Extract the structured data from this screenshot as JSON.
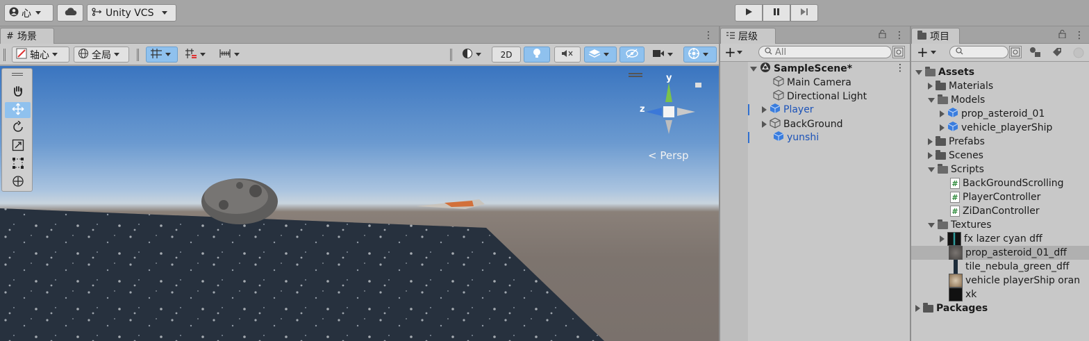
{
  "topbar": {
    "account_label": "心",
    "vcs_label": "Unity VCS"
  },
  "scene": {
    "tab_label": "场景",
    "pivot_label": "轴心",
    "global_label": "全局",
    "mode_2d_label": "2D",
    "persp_label": "< Persp",
    "gizmo_axes": {
      "y": "y",
      "z": "z"
    }
  },
  "hierarchy": {
    "tab_label": "层级",
    "search_placeholder": "All",
    "scene_name": "SampleScene*",
    "items": [
      {
        "label": "Main Camera",
        "prefab": false,
        "expandable": false
      },
      {
        "label": "Directional Light",
        "prefab": false,
        "expandable": false
      },
      {
        "label": "Player",
        "prefab": true,
        "expandable": true
      },
      {
        "label": "BackGround",
        "prefab": false,
        "expandable": true
      },
      {
        "label": "yunshi",
        "prefab": true,
        "expandable": false
      }
    ]
  },
  "project": {
    "tab_label": "项目",
    "assets_label": "Assets",
    "packages_label": "Packages",
    "folders": {
      "materials": "Materials",
      "models": "Models",
      "prefabs": "Prefabs",
      "scenes": "Scenes",
      "scripts": "Scripts",
      "textures": "Textures"
    },
    "models": [
      "prop_asteroid_01",
      "vehicle_playerShip"
    ],
    "scripts": [
      "BackGroundScrolling",
      "PlayerController",
      "ZiDanController"
    ],
    "textures": [
      "fx lazer cyan dff",
      "prop_asteroid_01_dff",
      "tile_nebula_green_dff",
      "vehicle playerShip oran",
      "xk"
    ]
  }
}
